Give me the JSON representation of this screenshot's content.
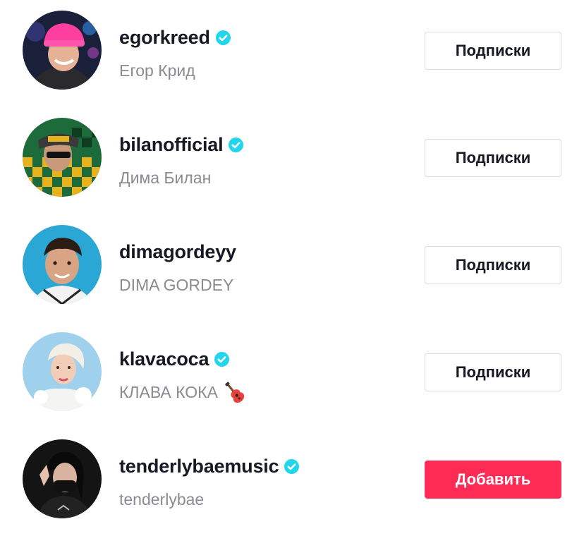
{
  "accounts": [
    {
      "username": "egorkreed",
      "display_name": "Егор Крид",
      "verified": true,
      "button_label": "Подписки",
      "button_state": "following"
    },
    {
      "username": "bilanofficial",
      "display_name": "Дима Билан",
      "verified": true,
      "button_label": "Подписки",
      "button_state": "following"
    },
    {
      "username": "dimagordeyy",
      "display_name": "DIMA GORDEY",
      "verified": false,
      "button_label": "Подписки",
      "button_state": "following"
    },
    {
      "username": "klavacoca",
      "display_name": "КЛАВА КОКА",
      "display_name_emoji": "guitar-emoji",
      "verified": true,
      "button_label": "Подписки",
      "button_state": "following"
    },
    {
      "username": "tenderlybaemusic",
      "display_name": "tenderlybae",
      "verified": true,
      "button_label": "Добавить",
      "button_state": "add"
    }
  ],
  "colors": {
    "verified_badge": "#20d5ec",
    "add_button": "#fe2c55",
    "username_text": "#161823",
    "nickname_text": "#8a8b91",
    "button_border": "#dcdcde"
  }
}
